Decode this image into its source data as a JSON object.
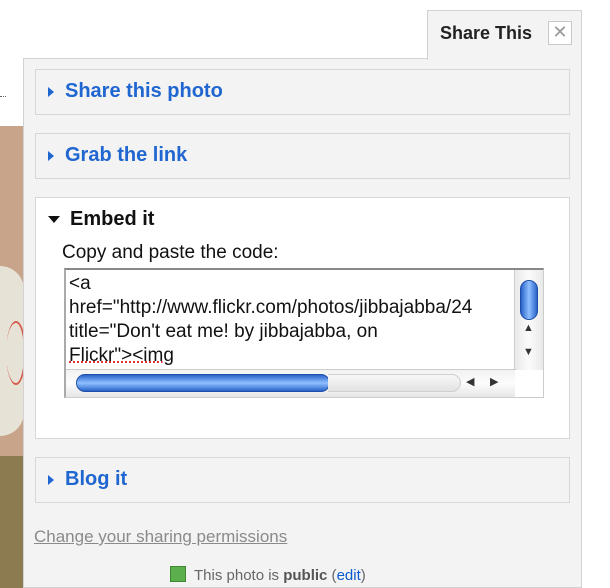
{
  "tab": {
    "title": "Share This",
    "close_glyph": "✕"
  },
  "sections": [
    {
      "label": "Share this photo",
      "state": "collapsed"
    },
    {
      "label": "Grab the link",
      "state": "collapsed"
    },
    {
      "label": "Embed it",
      "state": "expanded"
    },
    {
      "label": "Blog it",
      "state": "collapsed"
    }
  ],
  "embed": {
    "instruction": "Copy and paste the code:",
    "code_lines": [
      "<a",
      "href=\"http://www.flickr.com/photos/jibbajabba/24",
      "title=\"Don't eat me! by jibbajabba, on",
      "Flickr\"><img"
    ]
  },
  "scrollbar": {
    "up_arrow": "▲",
    "down_arrow": "▼",
    "left_arrow": "◀",
    "right_arrow": "▶"
  },
  "permissions_link": "Change your sharing permissions",
  "background_footer": {
    "text_prefix": "This photo is ",
    "status": "public",
    "paren_open": " (",
    "edit_link": "edit",
    "paren_close": ")"
  },
  "colors": {
    "link_blue": "#1f66d1",
    "panel_bg": "#f3f3f3",
    "scroll_blue": "#2a63c9"
  }
}
